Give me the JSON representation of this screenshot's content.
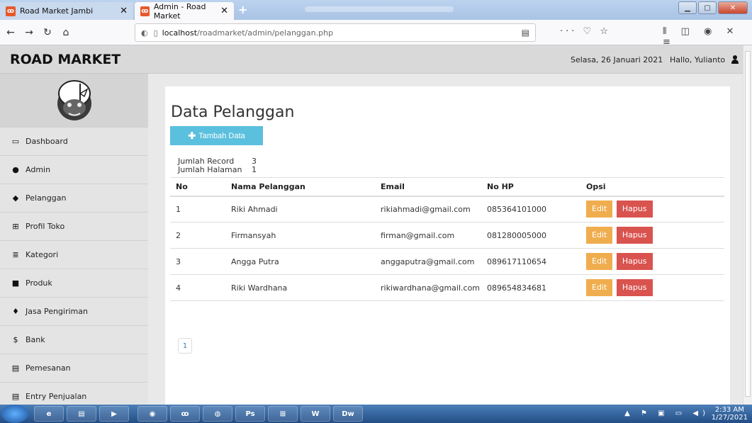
{
  "browser": {
    "tabs": [
      {
        "title": "Road Market Jambi",
        "active": false
      },
      {
        "title": "Admin - Road Market",
        "active": true
      }
    ],
    "url_prefix": "localhost",
    "url_path": "/roadmarket/admin/pelanggan.php"
  },
  "header": {
    "brand": "ROAD MARKET",
    "date": "Selasa, 26 Januari 2021",
    "greeting": "Hallo, Yulianto"
  },
  "sidebar": {
    "items": [
      {
        "icon": "▭",
        "label": "Dashboard"
      },
      {
        "icon": "●",
        "label": "Admin"
      },
      {
        "icon": "◆",
        "label": "Pelanggan"
      },
      {
        "icon": "⊞",
        "label": "Profil Toko"
      },
      {
        "icon": "≣",
        "label": "Kategori"
      },
      {
        "icon": "■",
        "label": "Produk"
      },
      {
        "icon": "♦",
        "label": "Jasa Pengiriman"
      },
      {
        "icon": "$",
        "label": "Bank"
      },
      {
        "icon": "▤",
        "label": "Pemesanan"
      },
      {
        "icon": "▤",
        "label": "Entry Penjualan"
      }
    ]
  },
  "main": {
    "title": "Data Pelanggan",
    "add_button": "Tambah Data",
    "meta": {
      "record_label": "Jumlah Record",
      "record_value": "3",
      "page_label": "Jumlah Halaman",
      "page_value": "1"
    },
    "table": {
      "headers": [
        "No",
        "Nama Pelanggan",
        "Email",
        "No HP",
        "Opsi"
      ],
      "rows": [
        [
          "1",
          "Riki Ahmadi",
          "rikiahmadi@gmail.com",
          "085364101000"
        ],
        [
          "2",
          "Firmansyah",
          "firman@gmail.com",
          "081280005000"
        ],
        [
          "3",
          "Angga Putra",
          "anggaputra@gmail.com",
          "089617110654"
        ],
        [
          "4",
          "Riki Wardhana",
          "rikiwardhana@gmail.com",
          "089654834681"
        ]
      ],
      "edit_label": "Edit",
      "delete_label": "Hapus"
    },
    "pagination": {
      "current": "1"
    }
  },
  "taskbar": {
    "apps": [
      "Ps",
      "Dw"
    ],
    "time": "2:33 AM",
    "date": "1/27/2021"
  },
  "colors": {
    "info": "#5bc0de",
    "warning": "#f0ad4e",
    "danger": "#d9534f"
  }
}
